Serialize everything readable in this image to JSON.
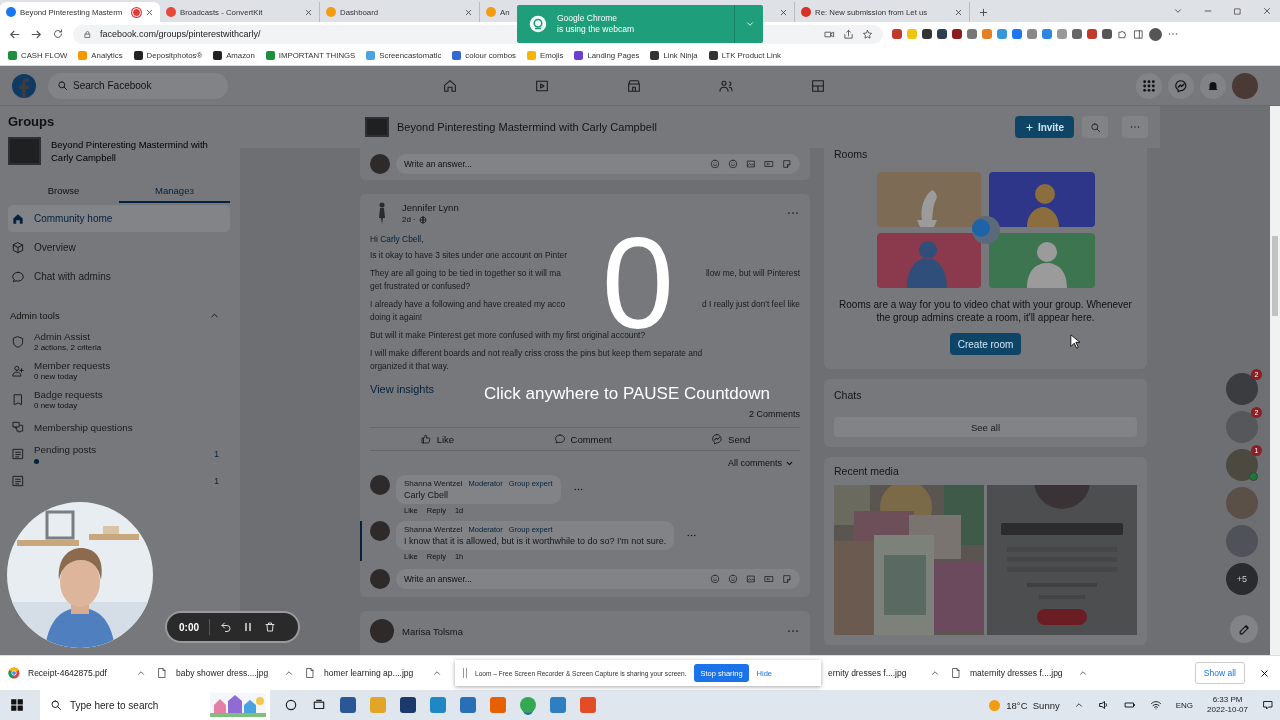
{
  "browser": {
    "tabs": [
      {
        "title": "Beyond Pinteresting Masterm",
        "selected": true,
        "recording": true
      },
      {
        "title": "Broadcasts - ConvertKit",
        "selected": false,
        "recording": false
      },
      {
        "title": "Dashboard",
        "selected": false,
        "recording": false
      },
      {
        "title": "An",
        "selected": false,
        "recording": false
      },
      {
        "title": "Re: New submission from Let us",
        "selected": false,
        "recording": false
      }
    ],
    "url": "facebook.com/groups/pinterestwithcarly/",
    "bookmarks": [
      "CASH FLOW",
      "Analytics",
      "Depositphotos®",
      "Amazon",
      "IMPORTANT THINGS",
      "Screencastomatic",
      "colour combos",
      "Emojis",
      "Landing Pages",
      "Link Ninja",
      "LTK Product Link"
    ],
    "notification": {
      "title": "Google Chrome",
      "text": "is using the webcam"
    }
  },
  "facebook": {
    "search": {
      "placeholder": "Search Facebook"
    },
    "sidebar": {
      "heading": "Groups",
      "group_name": "Beyond Pinteresting Mastermind with Carly Campbell",
      "tabs": [
        {
          "label": "Browse",
          "selected": false
        },
        {
          "label": "Manage",
          "count": "3",
          "selected": true
        }
      ],
      "nav": [
        {
          "label": "Community home",
          "selected": true
        },
        {
          "label": "Overview",
          "selected": false
        },
        {
          "label": "Chat with admins",
          "selected": false
        }
      ],
      "admin_tools": {
        "heading": "Admin tools",
        "expanded": true,
        "items": [
          {
            "title": "Admin Assist",
            "subtitle": "2 actions, 2 criteria",
            "unread": false
          },
          {
            "title": "Member requests",
            "subtitle": "0 new today",
            "unread": false
          },
          {
            "title": "Badge requests",
            "subtitle": "0 new today",
            "unread": false
          },
          {
            "title": "Membership questions",
            "unread": false
          },
          {
            "title": "Pending posts",
            "count": "1",
            "unread": true
          },
          {
            "count": "1",
            "unread": false
          }
        ]
      }
    },
    "group_header": {
      "title": "Beyond Pinteresting Mastermind with Carly Campbell",
      "invite": "Invite"
    },
    "feed": {
      "answer_placeholder": "Write an answer...",
      "post": {
        "author": "Jennifer Lynn",
        "time": "2d ·",
        "greeting": "Hi",
        "mention": "Carly Cbell",
        "greeting_end": ",",
        "paragraphs": [
          [
            [
              "Is it okay to have 3 sites under one account on Pinter"
            ]
          ],
          [
            [
              "They are all going to be tied in together so it will ma",
              "llow me, but will Pinterest"
            ],
            [
              "get frustrated or confused?"
            ]
          ],
          [
            [
              "I already have a following and have created my acco",
              "d I really just don't feel like"
            ],
            [
              "doing it again!"
            ]
          ],
          [
            [
              "But will it make Pinterest get more confused with my first original account?"
            ]
          ],
          [
            [
              "I will make different boards and not really criss cross the pins but keep them separate and"
            ],
            [
              "organized it that way."
            ]
          ]
        ],
        "insights": "View insights",
        "comments_count": "2 Comments",
        "actions": [
          "Like",
          "Comment",
          "Send"
        ],
        "sort": "All comments",
        "comments": [
          {
            "author": "Shanna Wentzel",
            "badges": [
              "Moderator",
              "Group expert"
            ],
            "text": "Carly Cbell",
            "actions": [
              "Like",
              "Reply"
            ],
            "age": "1d",
            "replies": [
              {
                "author": "Shanna Wentzel",
                "badges": [
                  "Moderator",
                  "Group expert"
                ],
                "text": "I know that it is allowed, but is it worthwhile to do so? I'm not sure.",
                "actions": [
                  "Like",
                  "Reply"
                ],
                "age": "1h"
              }
            ]
          }
        ],
        "reply_placeholder": "Write an answer..."
      },
      "next_post": {
        "author": "Marisa Tolsma"
      }
    },
    "right": {
      "rooms": {
        "title": "Rooms",
        "text": "Rooms are a way for you to video chat with your group. Whenever the group admins create a room, it'll appear here.",
        "button": "Create room"
      },
      "chats": {
        "title": "Chats",
        "button": "See all"
      },
      "media": {
        "title": "Recent media"
      }
    },
    "contacts": [
      {
        "badge": "2",
        "online": false
      },
      {
        "badge": "2",
        "online": false
      },
      {
        "badge": "1",
        "online": true
      },
      {
        "online": false
      },
      {
        "online": false
      },
      {
        "label": "+5",
        "online": false
      }
    ]
  },
  "countdown": {
    "digit": "0",
    "message": "Click anywhere to PAUSE Countdown"
  },
  "loom": {
    "time": "0:00",
    "banner": "Loom – Free Screen Recorder & Screen Capture is sharing your screen.",
    "stop": "Stop sharing",
    "hide": "Hide"
  },
  "downloads": {
    "items": [
      "Receipt-4642875.pdf",
      "baby shower dress....jpg",
      "homer learning ap....jpg",
      "ernity dresses f....jpg",
      "maternity dresses f....jpg"
    ],
    "show_all": "Show all"
  },
  "taskbar": {
    "search_placeholder": "Type here to search",
    "weather": "18°C  Sunny",
    "language": "ENG",
    "time": "6:33 PM",
    "date": "2022-10-07"
  }
}
